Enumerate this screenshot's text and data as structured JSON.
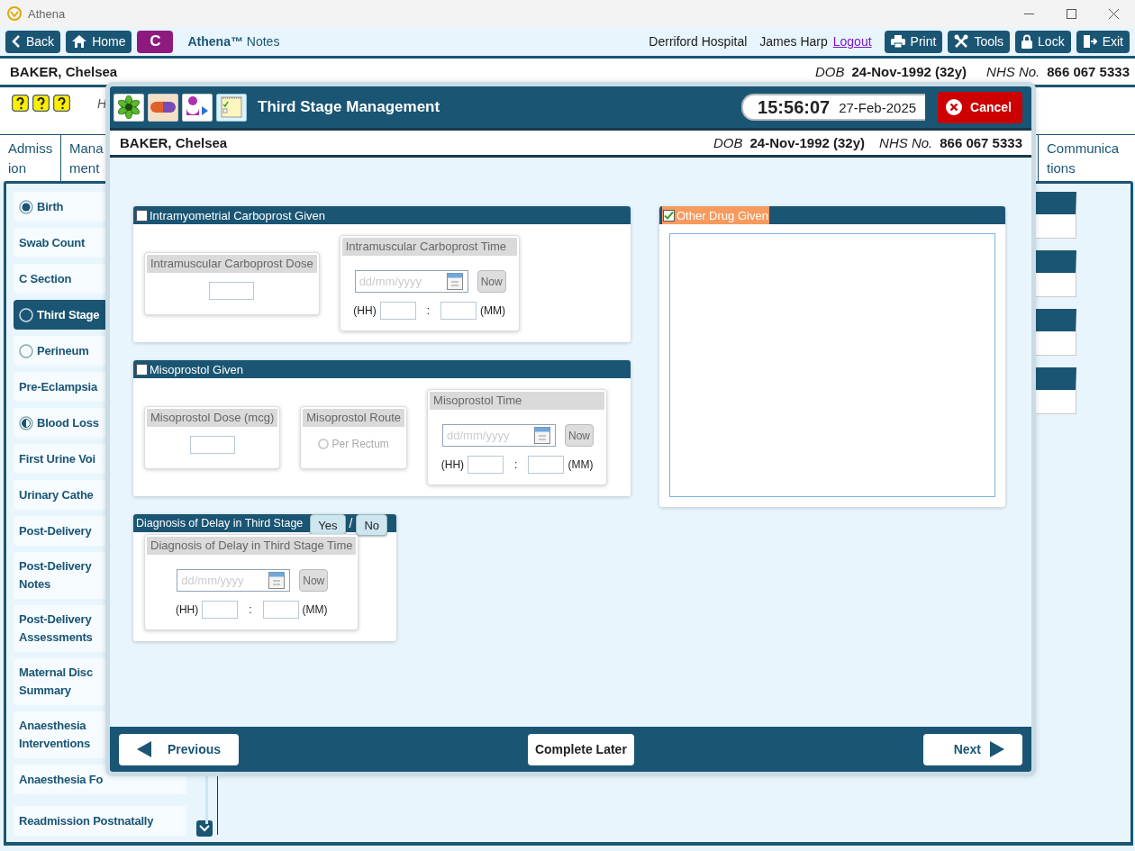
{
  "window": {
    "title": "Athena"
  },
  "toolbar": {
    "nav_buttons": [
      {
        "kind": "back",
        "label": "Back"
      },
      {
        "kind": "home",
        "label": "Home"
      }
    ],
    "module_badge": "C",
    "app_title": "**Athena™** Notes",
    "hospital": "Derriford Hospital",
    "user": "James Harp",
    "logout_link": "Logout",
    "action_buttons": [
      {
        "kind": "print",
        "label": "Print"
      },
      {
        "kind": "tools",
        "label": "Tools"
      },
      {
        "kind": "lock",
        "label": "Lock"
      },
      {
        "kind": "exit",
        "label": "Exit"
      }
    ]
  },
  "patient": {
    "name": "BAKER, Chelsea",
    "dob_label": "DOB",
    "dob": "24-Nov-1992 (32y)",
    "nhs_label": "NHS No.",
    "nhs": "866 067 5333"
  },
  "header_note": "H",
  "tabs": [
    {
      "label": "Admiss\nion",
      "selected": false
    },
    {
      "label": "Mana\nment",
      "selected": false
    },
    {
      "label": "Communica\ntions",
      "selected": false
    }
  ],
  "sidebar": {
    "items": [
      {
        "label": "Birth",
        "kind": "complete",
        "selected": false
      },
      {
        "label": "Swab Count",
        "kind": "plain",
        "selected": false
      },
      {
        "label": "C Section",
        "kind": "plain",
        "selected": false
      },
      {
        "label": "Third Stage",
        "kind": "empty",
        "selected": true
      },
      {
        "label": "Perineum",
        "kind": "empty",
        "selected": false
      },
      {
        "label": "Pre-Eclampsia",
        "kind": "plain",
        "selected": false
      },
      {
        "label": "Blood Loss",
        "kind": "partial",
        "selected": false
      },
      {
        "label": "First Urine Voi",
        "kind": "plain",
        "selected": false
      },
      {
        "label": "Urinary Cathe",
        "kind": "plain",
        "selected": false
      },
      {
        "label": "Post-Delivery",
        "kind": "plain",
        "selected": false
      },
      {
        "label": "Post-Delivery\nNotes",
        "kind": "plain",
        "selected": false
      },
      {
        "label": "Post-Delivery\nAssessments",
        "kind": "plain",
        "selected": false
      },
      {
        "label": "Maternal Disc\nSummary",
        "kind": "plain",
        "selected": false
      },
      {
        "label": "Anaesthesia\nInterventions",
        "kind": "plain",
        "selected": false
      },
      {
        "label": "Anaesthesia Fo",
        "kind": "plain",
        "selected": false
      },
      {
        "label": "Readmission Postnatally",
        "kind": "plain",
        "selected": false
      }
    ]
  },
  "dialog": {
    "title": "Third Stage Management",
    "time": "15:56:07",
    "date": "27-Feb-2025",
    "cancel": "Cancel",
    "patient": {
      "name": "BAKER, Chelsea",
      "dob_label": "DOB",
      "dob": "24-Nov-1992 (32y)",
      "nhs_label": "NHS No.",
      "nhs": "866 067 5333"
    },
    "sections": [
      {
        "kind": "checkbox",
        "label": "Intramyometrial Carboprost Given",
        "checked": false,
        "panels": [
          {
            "kind": "number",
            "title": "Intramuscular Carboprost Dose",
            "disabled": true
          },
          {
            "kind": "time",
            "title": "Intramuscular Carboprost Time",
            "disabled": true,
            "placeholder": "dd/mm/yyyy",
            "now": "Now",
            "hh": "(HH)",
            "separator": ":",
            "mm": "(MM)"
          }
        ]
      },
      {
        "kind": "checkbox",
        "label": "Misoprostol Given",
        "checked": false,
        "panels": [
          {
            "kind": "number",
            "title": "Misoprostol Dose (mcg)",
            "disabled": true
          },
          {
            "kind": "radio",
            "title": "Misoprostol Route",
            "disabled": true,
            "option": "Per Rectum",
            "selected": false
          },
          {
            "kind": "time",
            "title": "Misoprostol Time",
            "disabled": true,
            "placeholder": "dd/mm/yyyy",
            "now": "Now",
            "hh": "(HH)",
            "separator": ":",
            "mm": "(MM)"
          }
        ]
      },
      {
        "kind": "yes_no",
        "label": "Diagnosis of Delay in Third Stage",
        "options": [
          {
            "label": "Yes",
            "selected": false
          },
          {
            "label": "No",
            "selected": false
          }
        ],
        "separator": "/",
        "panels": [
          {
            "kind": "time",
            "title": "Diagnosis of Delay in Third Stage Time",
            "disabled": true,
            "placeholder": "dd/mm/yyyy",
            "now": "Now",
            "hh": "(HH)",
            "separator": ":",
            "mm": "(MM)"
          }
        ]
      }
    ],
    "other_drug": {
      "label": "Other Drug Given",
      "checked": true
    },
    "footer": {
      "previous": "Previous",
      "complete_later": "Complete Later",
      "next": "Next"
    }
  }
}
